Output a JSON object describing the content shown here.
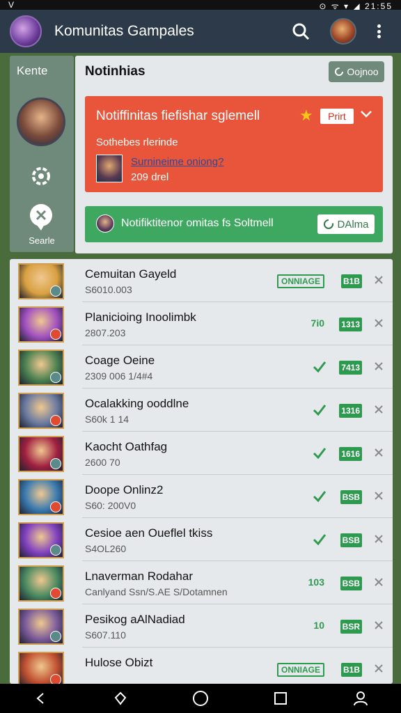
{
  "statusbar": {
    "left": "V",
    "right": "⊙ ᯤ ▾ ◢ 21:55"
  },
  "app": {
    "title": "Komunitas Gampales"
  },
  "sidebar": {
    "title": "Kente",
    "label": "Searle"
  },
  "notifications": {
    "title": "Notinhias",
    "open_label": "Oojnoo",
    "alert": {
      "title": "Notiffinitas fiefishar sglemell",
      "badge": "Prirt",
      "subtitle": "Sothebes rlerinde",
      "user": "Surnineime oniong?",
      "count": "209 drel"
    },
    "promo": {
      "text": "Notifiktitenor omitas fs Soltmell",
      "button": "DAlma"
    }
  },
  "list": [
    {
      "title": "Cemuitan Gayeld",
      "sub": "S6010.003",
      "status_type": "box",
      "status": "ONNIAGE",
      "code": "B1B",
      "thumb_color": "#d8a040"
    },
    {
      "title": "Planicioing Inoolimbk",
      "sub": "2807.203",
      "status_type": "text",
      "status": "7i0",
      "code": "1313",
      "thumb_color": "#a050c0"
    },
    {
      "title": "Coage Oeine",
      "sub": "2309 006 1/4#4",
      "status_type": "check",
      "status": "",
      "code": "7413",
      "thumb_color": "#4a8050"
    },
    {
      "title": "Ocalakking ooddlne",
      "sub": "S60k 1 14",
      "status_type": "check",
      "status": "",
      "code": "1316",
      "thumb_color": "#6a7aa0"
    },
    {
      "title": "Kaocht Oathfag",
      "sub": "2600 70",
      "status_type": "check",
      "status": "",
      "code": "1616",
      "thumb_color": "#a02040"
    },
    {
      "title": "Doope Onlinz2",
      "sub": "S60: 200V0",
      "status_type": "check",
      "status": "",
      "code": "BSB",
      "thumb_color": "#3a7ab0"
    },
    {
      "title": "Cesioe aen Oueflel tkiss",
      "sub": "S4OL260",
      "status_type": "check",
      "status": "",
      "code": "BSB",
      "thumb_color": "#8040c0"
    },
    {
      "title": "Lnaverman Rodahar",
      "sub": "Canlyand Ssn/S.AE S/Dotamnen",
      "status_type": "text",
      "status": "103",
      "code": "BSB",
      "thumb_color": "#4a8a60"
    },
    {
      "title": "Pesikog aAlNadiad",
      "sub": "S607.110",
      "status_type": "text",
      "status": "10",
      "code": "BSR",
      "thumb_color": "#7a5a9a"
    },
    {
      "title": "Hulose Obizt",
      "sub": "",
      "status_type": "box",
      "status": "ONNIAGE",
      "code": "B1B",
      "thumb_color": "#c05030"
    }
  ],
  "colors": {
    "accent_green": "#2e9a50",
    "alert_red": "#e8553a",
    "appbar": "#2d3a4a"
  }
}
